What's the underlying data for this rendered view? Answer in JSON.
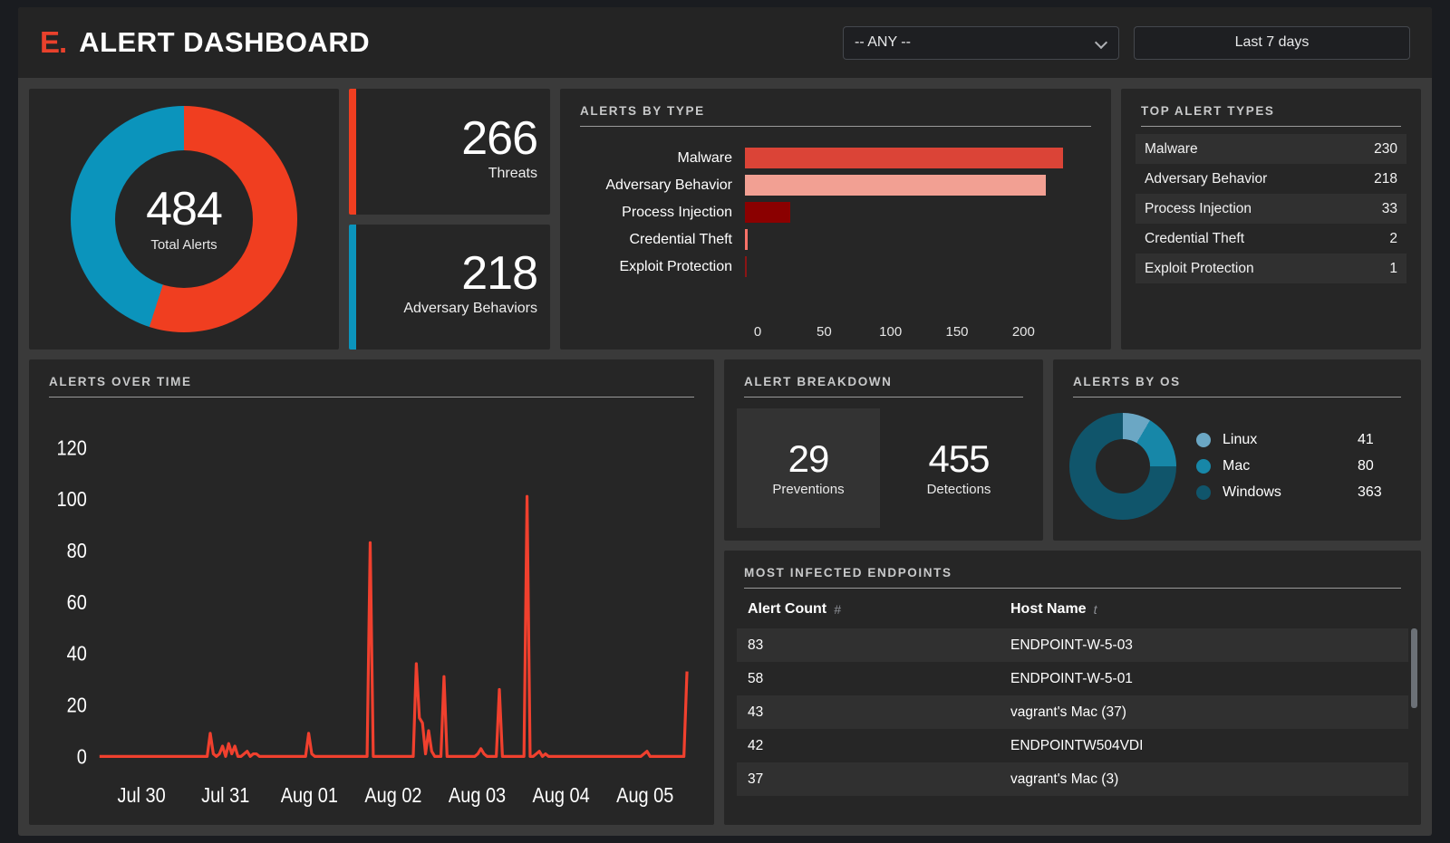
{
  "header": {
    "logo": "E.",
    "title": "ALERT DASHBOARD",
    "filter_value": "-- ANY --",
    "time_range": "Last 7 days"
  },
  "total_alerts": {
    "value": "484",
    "label": "Total Alerts"
  },
  "kpis": [
    {
      "value": "266",
      "label": "Threats",
      "color": "#F03E20"
    },
    {
      "value": "218",
      "label": "Adversary Behaviors",
      "color": "#0B94BC"
    }
  ],
  "alerts_by_type": {
    "title": "ALERTS BY TYPE"
  },
  "top_alert_types": {
    "title": "TOP ALERT TYPES",
    "rows": [
      {
        "name": "Malware",
        "value": "230"
      },
      {
        "name": "Adversary Behavior",
        "value": "218"
      },
      {
        "name": "Process Injection",
        "value": "33"
      },
      {
        "name": "Credential Theft",
        "value": "2"
      },
      {
        "name": "Exploit Protection",
        "value": "1"
      }
    ]
  },
  "alerts_over_time": {
    "title": "ALERTS OVER TIME"
  },
  "alert_breakdown": {
    "title": "ALERT BREAKDOWN",
    "preventions": {
      "value": "29",
      "label": "Preventions"
    },
    "detections": {
      "value": "455",
      "label": "Detections"
    }
  },
  "alerts_by_os": {
    "title": "ALERTS BY OS",
    "items": [
      {
        "name": "Linux",
        "value": "41",
        "color": "#6BA7C4"
      },
      {
        "name": "Mac",
        "value": "80",
        "color": "#1787A8"
      },
      {
        "name": "Windows",
        "value": "363",
        "color": "#10556B"
      }
    ]
  },
  "most_infected_endpoints": {
    "title": "MOST INFECTED ENDPOINTS",
    "columns": [
      {
        "label": "Alert Count",
        "sort": "#"
      },
      {
        "label": "Host Name",
        "sort": "t"
      }
    ],
    "rows": [
      {
        "count": "83",
        "host": "ENDPOINT-W-5-03"
      },
      {
        "count": "58",
        "host": "ENDPOINT-W-5-01"
      },
      {
        "count": "43",
        "host": "vagrant's Mac (37)"
      },
      {
        "count": "42",
        "host": "ENDPOINTW504VDI"
      },
      {
        "count": "37",
        "host": "vagrant's Mac (3)"
      }
    ]
  },
  "chart_data": [
    {
      "type": "bar",
      "title": "ALERTS BY TYPE",
      "orientation": "horizontal",
      "categories": [
        "Malware",
        "Adversary Behavior",
        "Process Injection",
        "Credential Theft",
        "Exploit Protection"
      ],
      "values": [
        230,
        218,
        33,
        2,
        1
      ],
      "colors": [
        "#DB4437",
        "#F2A093",
        "#8B0000",
        "#FA7268",
        "#8B1515"
      ],
      "xlabel": "",
      "ylabel": "",
      "xlim": [
        0,
        240
      ],
      "xticks": [
        0,
        50,
        100,
        150,
        200
      ],
      "grid": false,
      "legend": false
    },
    {
      "type": "pie",
      "title": "Total Alerts",
      "labels": [
        "Threats",
        "Adversary Behaviors"
      ],
      "values": [
        266,
        218
      ],
      "colors": [
        "#F03E20",
        "#0B94BC"
      ],
      "total": 484,
      "donut": true
    },
    {
      "type": "pie",
      "title": "ALERTS BY OS",
      "labels": [
        "Linux",
        "Mac",
        "Windows"
      ],
      "values": [
        41,
        80,
        363
      ],
      "colors": [
        "#6BA7C4",
        "#1787A8",
        "#10556B"
      ],
      "total": 484,
      "donut": true,
      "legend": "right"
    },
    {
      "type": "line",
      "title": "ALERTS OVER TIME",
      "xlabel": "",
      "ylabel": "",
      "ylim": [
        0,
        130
      ],
      "yticks": [
        0,
        20,
        40,
        60,
        80,
        100,
        120
      ],
      "xticks": [
        "Jul 30",
        "Jul 31",
        "Aug 01",
        "Aug 02",
        "Aug 03",
        "Aug 04",
        "Aug 05"
      ],
      "color": "#F0402E",
      "grid": false,
      "series": [
        {
          "name": "Alerts",
          "values": [
            0,
            0,
            0,
            0,
            0,
            0,
            0,
            0,
            0,
            0,
            0,
            0,
            0,
            0,
            0,
            0,
            0,
            0,
            0,
            0,
            0,
            0,
            0,
            0,
            0,
            0,
            0,
            0,
            0,
            0,
            0,
            0,
            0,
            0,
            0,
            0,
            9,
            1,
            0,
            1,
            4,
            0,
            5,
            1,
            4,
            0,
            0,
            1,
            2,
            0,
            1,
            1,
            0,
            0,
            0,
            0,
            0,
            0,
            0,
            0,
            0,
            0,
            0,
            0,
            0,
            0,
            0,
            0,
            9,
            1,
            0,
            0,
            0,
            0,
            0,
            0,
            0,
            0,
            0,
            0,
            0,
            0,
            0,
            0,
            0,
            0,
            0,
            0,
            83,
            0,
            0,
            0,
            0,
            0,
            0,
            0,
            0,
            0,
            0,
            0,
            0,
            0,
            0,
            36,
            15,
            13,
            1,
            10,
            2,
            0,
            0,
            0,
            31,
            0,
            0,
            0,
            0,
            0,
            0,
            0,
            0,
            0,
            0,
            1,
            3,
            1,
            0,
            0,
            0,
            0,
            26,
            0,
            0,
            0,
            0,
            0,
            0,
            0,
            0,
            101,
            0,
            0,
            1,
            2,
            0,
            1,
            0,
            0,
            0,
            0,
            0,
            0,
            0,
            0,
            0,
            0,
            0,
            0,
            0,
            0,
            0,
            0,
            0,
            0,
            0,
            0,
            0,
            0,
            0,
            0,
            0,
            0,
            0,
            0,
            0,
            0,
            0,
            1,
            2,
            0,
            0,
            0,
            0,
            0,
            0,
            0,
            0,
            0,
            0,
            0,
            0,
            33
          ]
        }
      ]
    }
  ]
}
